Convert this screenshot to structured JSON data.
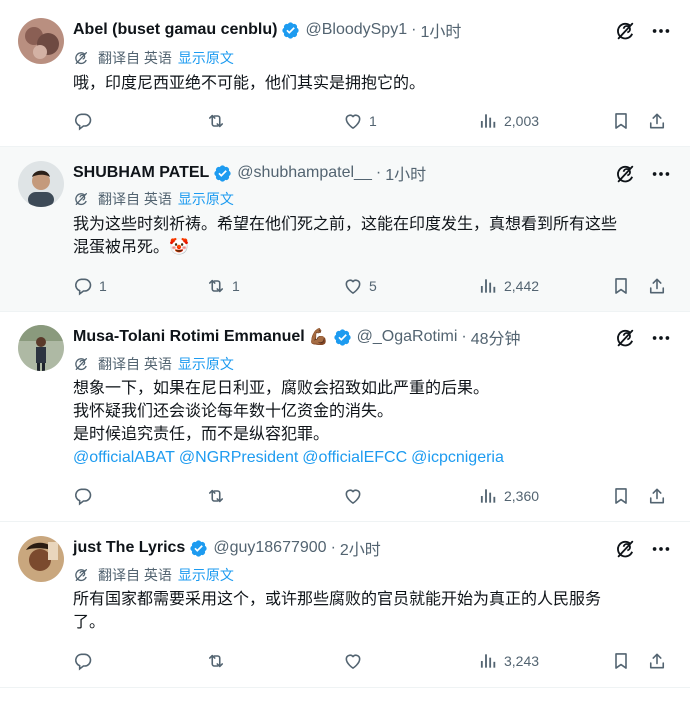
{
  "translate": {
    "label": "翻译自 英语",
    "show_original": "显示原文"
  },
  "tweets": [
    {
      "name": "Abel (buset gamau cenblu)",
      "handle": "@BloodySpy1",
      "sep": "·",
      "time": "1小时",
      "lines": [
        "哦，印度尼西亚绝不可能，他们其实是拥抱它的。"
      ],
      "replies": "",
      "retweets": "",
      "likes": "1",
      "views": "2,003"
    },
    {
      "name": "SHUBHAM PATEL",
      "handle": "@shubhampatel__",
      "sep": "·",
      "time": "1小时",
      "lines": [
        "我为这些时刻祈祷。希望在他们死之前，这能在印度发生，真想看到所有这些",
        "混蛋被吊死。🤡"
      ],
      "replies": "1",
      "retweets": "1",
      "likes": "5",
      "views": "2,442"
    },
    {
      "name": "Musa-Tolani Rotimi Emmanuel",
      "name_emoji": "💪🏾",
      "handle": "@_OgaRotimi",
      "sep": "·",
      "time": "48分钟",
      "lines": [
        "想象一下，如果在尼日利亚，腐败会招致如此严重的后果。",
        "我怀疑我们还会谈论每年数十亿资金的消失。",
        "是时候追究责任，而不是纵容犯罪。"
      ],
      "mentions": [
        "@officialABAT",
        "@NGRPresident",
        "@officialEFCC",
        "@icpcnigeria"
      ],
      "replies": "",
      "retweets": "",
      "likes": "",
      "views": "2,360"
    },
    {
      "name": "just The Lyrics",
      "handle": "@guy18677900",
      "sep": "·",
      "time": "2小时",
      "lines": [
        "所有国家都需要采用这个，或许那些腐败的官员就能开始为真正的人民服务",
        "了。"
      ],
      "replies": "",
      "retweets": "",
      "likes": "",
      "views": "3,243"
    }
  ],
  "colors": {
    "accent": "#1d9bf0",
    "secondary": "#536471",
    "text": "#0f1419",
    "divider": "#eff3f4"
  },
  "icons": [
    "verified-badge-icon",
    "grok-icon",
    "more-icon",
    "globe-translate-icon",
    "reply-icon",
    "retweet-icon",
    "like-icon",
    "views-icon",
    "bookmark-icon",
    "share-icon"
  ]
}
